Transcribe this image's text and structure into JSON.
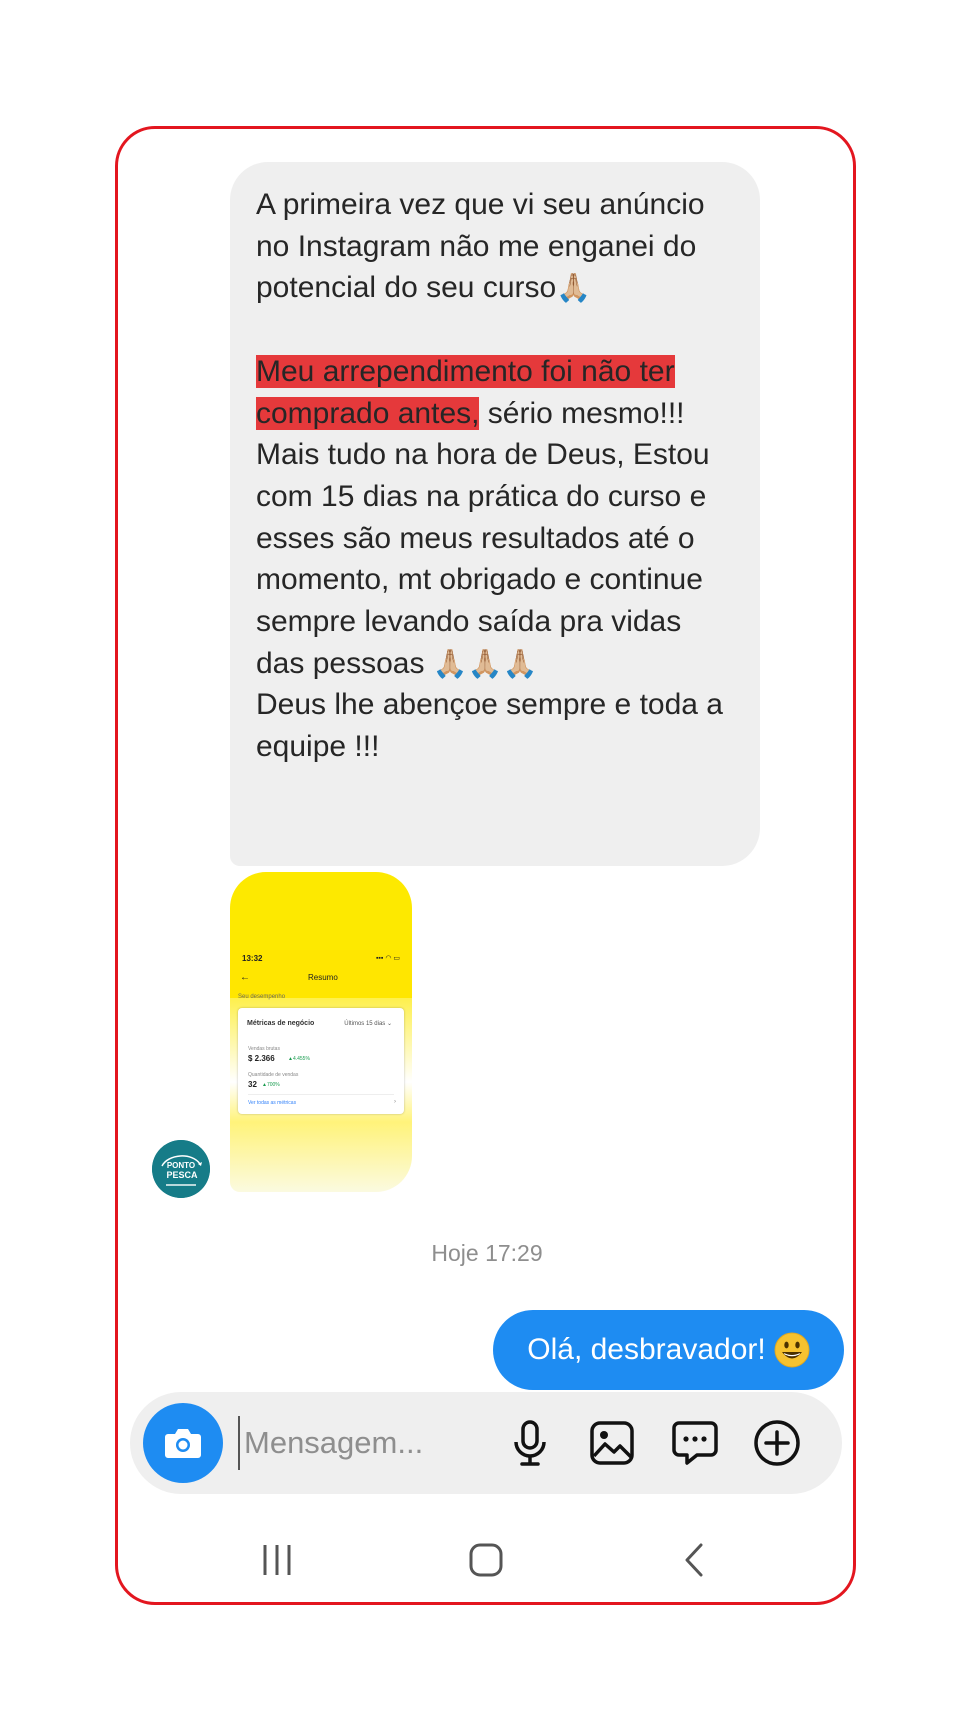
{
  "incoming_message": {
    "intro": "A primeira vez que vi seu anúncio no Instagram não me enganei do potencial do seu curso",
    "intro_emoji": "🙏🏼",
    "highlight": "Meu arrependimento foi não ter comprado antes,",
    "after_highlight": " sério mesmo!!!",
    "body": "Mais tudo na hora de Deus, Estou com 15 dias na prática do curso e esses são meus resultados até o momento, mt obrigado e continue sempre levando saída pra vidas das pessoas ",
    "body_emoji": "🙏🏼🙏🏼🙏🏼",
    "closing": "Deus lhe abençoe sempre e toda a equipe !!!",
    "highlight_color": "#e5393b"
  },
  "shared_screenshot": {
    "time": "13:32",
    "status_icons": "▪▪▪ ◠ ▭",
    "back_arrow": "←",
    "title": "Resumo",
    "subtitle": "Seu desempenho",
    "card_title": "Métricas de negócio",
    "period": "Últimos 15 dias ⌄",
    "metric1_label": "Vendas brutas",
    "metric1_value": "$ 2.366",
    "metric1_change": "▲4.455%",
    "metric2_label": "Quantidade de vendas",
    "metric2_value": "32",
    "metric2_change": "▲700%",
    "link": "Ver todas as métricas",
    "link_arrow": "›",
    "accent": "#ffe600"
  },
  "avatar": {
    "line1": "PONTO",
    "line2": "PESCA",
    "color": "#167c88"
  },
  "timestamp": "Hoje 17:29",
  "outgoing_message": {
    "text": "Olá, desbravador!",
    "emoji_icon": "grinning-face-icon",
    "color": "#1e8cf2"
  },
  "composer": {
    "placeholder": "Mensagem...",
    "icons": [
      "camera-icon",
      "microphone-icon",
      "gallery-icon",
      "sticker-icon",
      "add-icon"
    ]
  },
  "navbar": {
    "icons": [
      "recent-apps-icon",
      "home-icon",
      "back-icon"
    ]
  }
}
